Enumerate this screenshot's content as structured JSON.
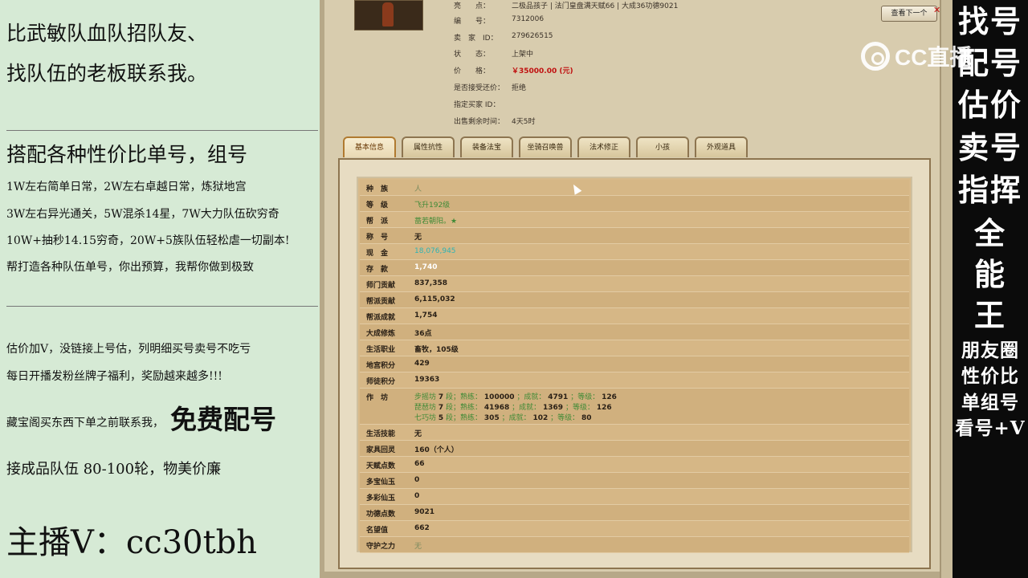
{
  "left_panel": {
    "line1": "比武敏队血队招队友、",
    "line2": "找队伍的老板联系我。",
    "line3": "搭配各种性价比单号，组号",
    "line4": "1W左右简单日常，2W左右卓越日常，炼狱地宫",
    "line5": "3W左右异光通关，5W混杀14星，7W大力队伍砍穷奇",
    "line6": "10W+抽秒14.15穷奇，20W+5族队伍轻松虐一切副本!",
    "line7": "帮打造各种队伍单号，你出预算，我帮你做到极致",
    "line8": "估价加V，没链接上号估，列明细买号卖号不吃亏",
    "line9": "每日开播发粉丝牌子福利，奖励越来越多!!!",
    "line10": "藏宝阁买东西下单之前联系我，",
    "line10_big": "免费配号",
    "line11": "接成品队伍 80-100轮，物美价廉",
    "host_label": "主播V：cc30tbh"
  },
  "right_panel": {
    "big_chars": [
      "找号",
      "配号",
      "估价",
      "卖号",
      "指挥",
      "全",
      "能",
      "王"
    ],
    "small_lines": [
      "朋友圈",
      "性价比",
      "单组号",
      "看号+V"
    ]
  },
  "watermark": {
    "text": "CC直播"
  },
  "item_info": {
    "rows": [
      {
        "label": "亮　　点：",
        "value": "二极品孩子 | 法门皇盘满天赋66 | 大成36功德9021"
      },
      {
        "label": "编　　号：",
        "value": "7312006"
      },
      {
        "label": "卖　家　ID：",
        "value": "279626515"
      },
      {
        "label": "状　　态：",
        "value": "上架中"
      },
      {
        "label": "价　　格：",
        "value": "￥35000.00 (元)"
      },
      {
        "label": "是否接受还价：",
        "value": "拒绝"
      },
      {
        "label": "指定买家 ID：",
        "value": ""
      },
      {
        "label": "出售剩余时间：",
        "value": "4天5时"
      }
    ],
    "next_button": "查看下一个",
    "close_icon": "x-icon"
  },
  "tabs": [
    "基本信息",
    "属性抗性",
    "装备法宝",
    "坐骑召唤兽",
    "法术修正",
    "小孩",
    "外观道具"
  ],
  "stats": [
    {
      "k": "种　族",
      "v": "人",
      "style": "dim"
    },
    {
      "k": "等　级",
      "v": "飞升192级",
      "style": "green"
    },
    {
      "k": "帮　派",
      "v": "蔷若朝阳。★",
      "style": "green"
    },
    {
      "k": "称　号",
      "v": "无",
      "style": ""
    },
    {
      "k": "现　金",
      "v": "18,076,945",
      "style": "teal"
    },
    {
      "k": "存　款",
      "v": "1,740",
      "style": "white"
    },
    {
      "k": "师门贡献",
      "v": "837,358",
      "style": ""
    },
    {
      "k": "帮派贡献",
      "v": "6,115,032",
      "style": ""
    },
    {
      "k": "帮派成就",
      "v": "1,754",
      "style": ""
    },
    {
      "k": "大成修炼",
      "v": "36点",
      "style": ""
    },
    {
      "k": "生活职业",
      "v": "畜牧，105级",
      "style": ""
    },
    {
      "k": "地宫积分",
      "v": "429",
      "style": ""
    },
    {
      "k": "师徒积分",
      "v": "19363",
      "style": ""
    }
  ],
  "workshop": {
    "label": "作　坊",
    "lines": [
      {
        "name": "步摇坊",
        "lv": "7",
        "seg": "段；熟练：",
        "exp": "100000",
        "a": "；成就：",
        "ach": "4791",
        "b": "；等级：",
        "grade": "126"
      },
      {
        "name": "琵琶坊",
        "lv": "7",
        "seg": "段；熟练：",
        "exp": "41968",
        "a": "；成就：",
        "ach": "1369",
        "b": "；等级：",
        "grade": "126"
      },
      {
        "name": "七巧坊",
        "lv": "5",
        "seg": "段；熟练：",
        "exp": "305",
        "a": "；成就：",
        "ach": "102",
        "b": "；等级：",
        "grade": "80"
      }
    ]
  },
  "stats2": [
    {
      "k": "生活技能",
      "v": "无",
      "style": ""
    },
    {
      "k": "家具回灵",
      "v": "160（个人）",
      "style": ""
    },
    {
      "k": "天赋点数",
      "v": "66",
      "style": ""
    },
    {
      "k": "多宝仙玉",
      "v": "0",
      "style": ""
    },
    {
      "k": "多彩仙玉",
      "v": "0",
      "style": ""
    },
    {
      "k": "功德点数",
      "v": "9021",
      "style": ""
    },
    {
      "k": "名望值",
      "v": "662",
      "style": ""
    },
    {
      "k": "守护之力",
      "v": "无",
      "style": "dim"
    }
  ]
}
